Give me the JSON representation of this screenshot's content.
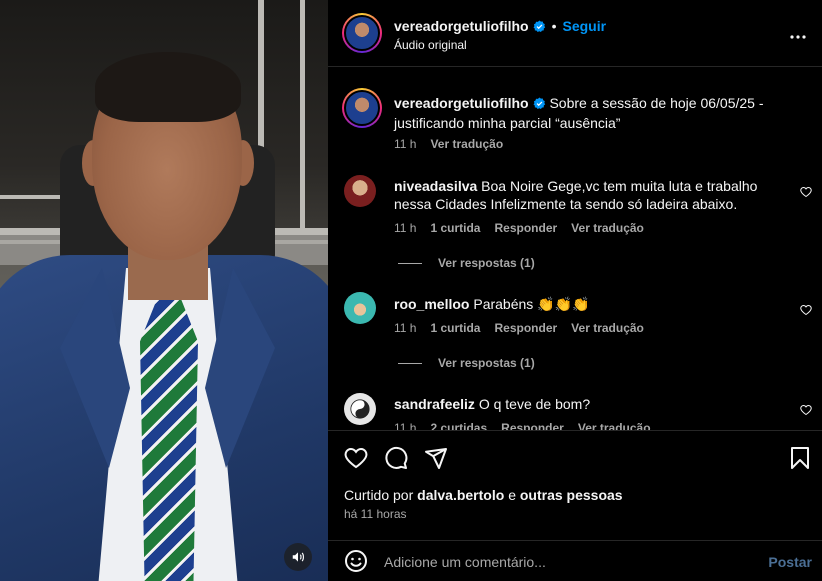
{
  "header": {
    "username": "vereadorgetuliofilho",
    "follow_label": "Seguir",
    "dot": "•",
    "audio_label": "Áudio original"
  },
  "caption": {
    "username": "vereadorgetuliofilho",
    "text": "Sobre a sessão de hoje 06/05/25 - justificando minha parcial “ausência”",
    "time": "11 h",
    "translate": "Ver tradução"
  },
  "comments": [
    {
      "username": "niveadasilva",
      "text": "Boa Noire Gege,vc tem muita luta e trabalho nessa Cidades Infelizmente ta sendo só ladeira abaixo.",
      "time": "11 h",
      "likes": "1 curtida",
      "reply": "Responder",
      "translate": "Ver tradução",
      "view_replies": "Ver respostas (1)"
    },
    {
      "username": "roo_melloo",
      "text": "Parabéns 👏👏👏",
      "time": "11 h",
      "likes": "1 curtida",
      "reply": "Responder",
      "translate": "Ver tradução",
      "view_replies": "Ver respostas (1)"
    },
    {
      "username": "sandrafeeliz",
      "text": "O q teve de bom?",
      "time": "11 h",
      "likes": "2 curtidas",
      "reply": "Responder",
      "translate": "Ver tradução"
    }
  ],
  "likes_line": {
    "prefix": "Curtido por",
    "user": "dalva.bertolo",
    "conj": "e",
    "others": "outras pessoas"
  },
  "timestamp": "há 11 horas",
  "add_comment": {
    "placeholder": "Adicione um comentário...",
    "post_label": "Postar"
  },
  "colors": {
    "link_blue": "#0095f6",
    "verified_blue": "#0095f6",
    "muted_text": "#a8a8a8",
    "post_disabled": "#4b6f95"
  },
  "icons": [
    "more-icon",
    "verified-icon",
    "heart-icon",
    "comment-icon",
    "share-icon",
    "bookmark-icon",
    "emoji-icon",
    "volume-icon"
  ]
}
